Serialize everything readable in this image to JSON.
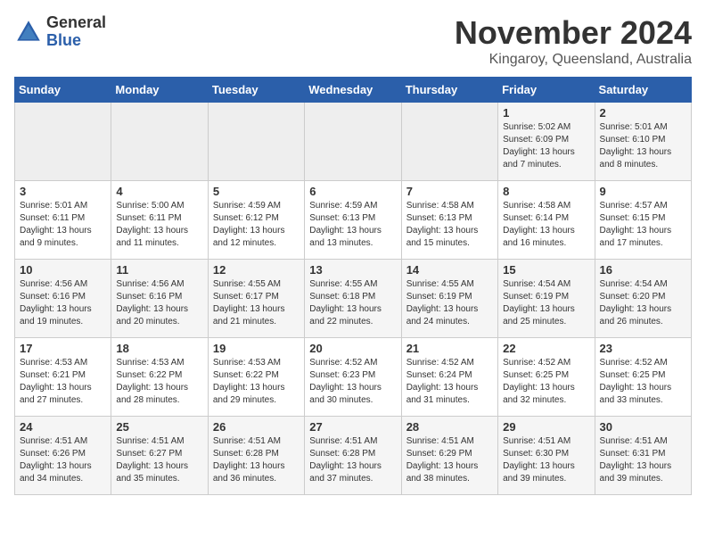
{
  "header": {
    "logo_line1": "General",
    "logo_line2": "Blue",
    "month": "November 2024",
    "location": "Kingaroy, Queensland, Australia"
  },
  "weekdays": [
    "Sunday",
    "Monday",
    "Tuesday",
    "Wednesday",
    "Thursday",
    "Friday",
    "Saturday"
  ],
  "weeks": [
    [
      {
        "day": "",
        "info": ""
      },
      {
        "day": "",
        "info": ""
      },
      {
        "day": "",
        "info": ""
      },
      {
        "day": "",
        "info": ""
      },
      {
        "day": "",
        "info": ""
      },
      {
        "day": "1",
        "info": "Sunrise: 5:02 AM\nSunset: 6:09 PM\nDaylight: 13 hours\nand 7 minutes."
      },
      {
        "day": "2",
        "info": "Sunrise: 5:01 AM\nSunset: 6:10 PM\nDaylight: 13 hours\nand 8 minutes."
      }
    ],
    [
      {
        "day": "3",
        "info": "Sunrise: 5:01 AM\nSunset: 6:11 PM\nDaylight: 13 hours\nand 9 minutes."
      },
      {
        "day": "4",
        "info": "Sunrise: 5:00 AM\nSunset: 6:11 PM\nDaylight: 13 hours\nand 11 minutes."
      },
      {
        "day": "5",
        "info": "Sunrise: 4:59 AM\nSunset: 6:12 PM\nDaylight: 13 hours\nand 12 minutes."
      },
      {
        "day": "6",
        "info": "Sunrise: 4:59 AM\nSunset: 6:13 PM\nDaylight: 13 hours\nand 13 minutes."
      },
      {
        "day": "7",
        "info": "Sunrise: 4:58 AM\nSunset: 6:13 PM\nDaylight: 13 hours\nand 15 minutes."
      },
      {
        "day": "8",
        "info": "Sunrise: 4:58 AM\nSunset: 6:14 PM\nDaylight: 13 hours\nand 16 minutes."
      },
      {
        "day": "9",
        "info": "Sunrise: 4:57 AM\nSunset: 6:15 PM\nDaylight: 13 hours\nand 17 minutes."
      }
    ],
    [
      {
        "day": "10",
        "info": "Sunrise: 4:56 AM\nSunset: 6:16 PM\nDaylight: 13 hours\nand 19 minutes."
      },
      {
        "day": "11",
        "info": "Sunrise: 4:56 AM\nSunset: 6:16 PM\nDaylight: 13 hours\nand 20 minutes."
      },
      {
        "day": "12",
        "info": "Sunrise: 4:55 AM\nSunset: 6:17 PM\nDaylight: 13 hours\nand 21 minutes."
      },
      {
        "day": "13",
        "info": "Sunrise: 4:55 AM\nSunset: 6:18 PM\nDaylight: 13 hours\nand 22 minutes."
      },
      {
        "day": "14",
        "info": "Sunrise: 4:55 AM\nSunset: 6:19 PM\nDaylight: 13 hours\nand 24 minutes."
      },
      {
        "day": "15",
        "info": "Sunrise: 4:54 AM\nSunset: 6:19 PM\nDaylight: 13 hours\nand 25 minutes."
      },
      {
        "day": "16",
        "info": "Sunrise: 4:54 AM\nSunset: 6:20 PM\nDaylight: 13 hours\nand 26 minutes."
      }
    ],
    [
      {
        "day": "17",
        "info": "Sunrise: 4:53 AM\nSunset: 6:21 PM\nDaylight: 13 hours\nand 27 minutes."
      },
      {
        "day": "18",
        "info": "Sunrise: 4:53 AM\nSunset: 6:22 PM\nDaylight: 13 hours\nand 28 minutes."
      },
      {
        "day": "19",
        "info": "Sunrise: 4:53 AM\nSunset: 6:22 PM\nDaylight: 13 hours\nand 29 minutes."
      },
      {
        "day": "20",
        "info": "Sunrise: 4:52 AM\nSunset: 6:23 PM\nDaylight: 13 hours\nand 30 minutes."
      },
      {
        "day": "21",
        "info": "Sunrise: 4:52 AM\nSunset: 6:24 PM\nDaylight: 13 hours\nand 31 minutes."
      },
      {
        "day": "22",
        "info": "Sunrise: 4:52 AM\nSunset: 6:25 PM\nDaylight: 13 hours\nand 32 minutes."
      },
      {
        "day": "23",
        "info": "Sunrise: 4:52 AM\nSunset: 6:25 PM\nDaylight: 13 hours\nand 33 minutes."
      }
    ],
    [
      {
        "day": "24",
        "info": "Sunrise: 4:51 AM\nSunset: 6:26 PM\nDaylight: 13 hours\nand 34 minutes."
      },
      {
        "day": "25",
        "info": "Sunrise: 4:51 AM\nSunset: 6:27 PM\nDaylight: 13 hours\nand 35 minutes."
      },
      {
        "day": "26",
        "info": "Sunrise: 4:51 AM\nSunset: 6:28 PM\nDaylight: 13 hours\nand 36 minutes."
      },
      {
        "day": "27",
        "info": "Sunrise: 4:51 AM\nSunset: 6:28 PM\nDaylight: 13 hours\nand 37 minutes."
      },
      {
        "day": "28",
        "info": "Sunrise: 4:51 AM\nSunset: 6:29 PM\nDaylight: 13 hours\nand 38 minutes."
      },
      {
        "day": "29",
        "info": "Sunrise: 4:51 AM\nSunset: 6:30 PM\nDaylight: 13 hours\nand 39 minutes."
      },
      {
        "day": "30",
        "info": "Sunrise: 4:51 AM\nSunset: 6:31 PM\nDaylight: 13 hours\nand 39 minutes."
      }
    ]
  ]
}
